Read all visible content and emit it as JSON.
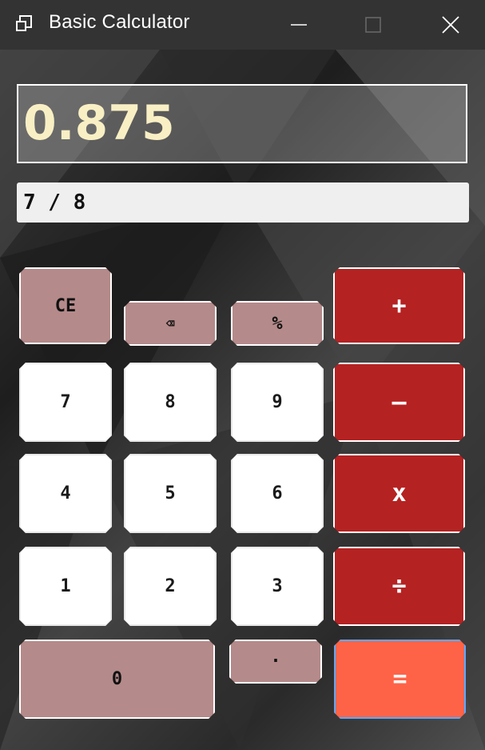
{
  "window": {
    "title": "Basic Calculator",
    "icon": "app-window-icon",
    "controls": [
      "minimize-icon",
      "maximize-icon",
      "close-icon"
    ]
  },
  "display": {
    "value": "0.875"
  },
  "expression": {
    "text": "7 / 8"
  },
  "keys": {
    "ce": "CE",
    "backspace": "⌫",
    "percent": "%",
    "plus": "+",
    "seven": "7",
    "eight": "8",
    "nine": "9",
    "minus": "–",
    "four": "4",
    "five": "5",
    "six": "6",
    "multiply": "x",
    "one": "1",
    "two": "2",
    "three": "3",
    "divide": "÷",
    "zero": "0",
    "decimal": "·",
    "equals": "="
  },
  "colors": {
    "title_bar": "#333333",
    "display_text": "#f8efc4",
    "digit_key": "#ffffff",
    "function_key": "#b58a8a",
    "operator_key": "#b52222",
    "equals_key": "#ff6347"
  }
}
